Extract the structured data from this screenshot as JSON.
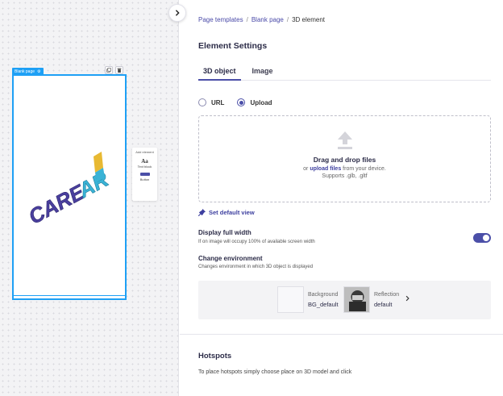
{
  "canvas": {
    "page_tag": "Blank page",
    "add_panel": {
      "title": "Add element",
      "text_block_icon": "Aa",
      "text_block_label": "Text block",
      "button_label": "Button"
    },
    "model_icon": "carear-3d-model"
  },
  "breadcrumb": {
    "items": [
      "Page templates",
      "Blank page",
      "3D element"
    ],
    "separator": "/"
  },
  "settings": {
    "title": "Element Settings",
    "tabs": [
      {
        "label": "3D object",
        "active": true
      },
      {
        "label": "Image",
        "active": false
      }
    ],
    "source": {
      "options": [
        "URL",
        "Upload"
      ],
      "selected": "Upload"
    },
    "dropzone": {
      "title": "Drag and drop files",
      "prefix": "or",
      "link": "upload files",
      "suffix": "from your device.",
      "types": "Supports .glb, .gltf"
    },
    "default_view_label": "Set default view",
    "full_width": {
      "title": "Display full width",
      "description": "If on image will occupy 100% of available screen width",
      "enabled": true
    },
    "environment": {
      "title": "Change environment",
      "description": "Changes environment in which 3D object is displayed",
      "background_label": "Background",
      "background_value": "BG_default",
      "reflection_label": "Reflection",
      "reflection_value": "default"
    }
  },
  "hotspots": {
    "title": "Hotspots",
    "description": "To place hotspots simply choose place on 3D model and click"
  },
  "colors": {
    "accent": "#4b4fa8",
    "selection": "#1ea0f5",
    "logo_purple": "#4a3f9e",
    "logo_cyan": "#3ab3d6",
    "logo_yellow": "#e8b932"
  }
}
